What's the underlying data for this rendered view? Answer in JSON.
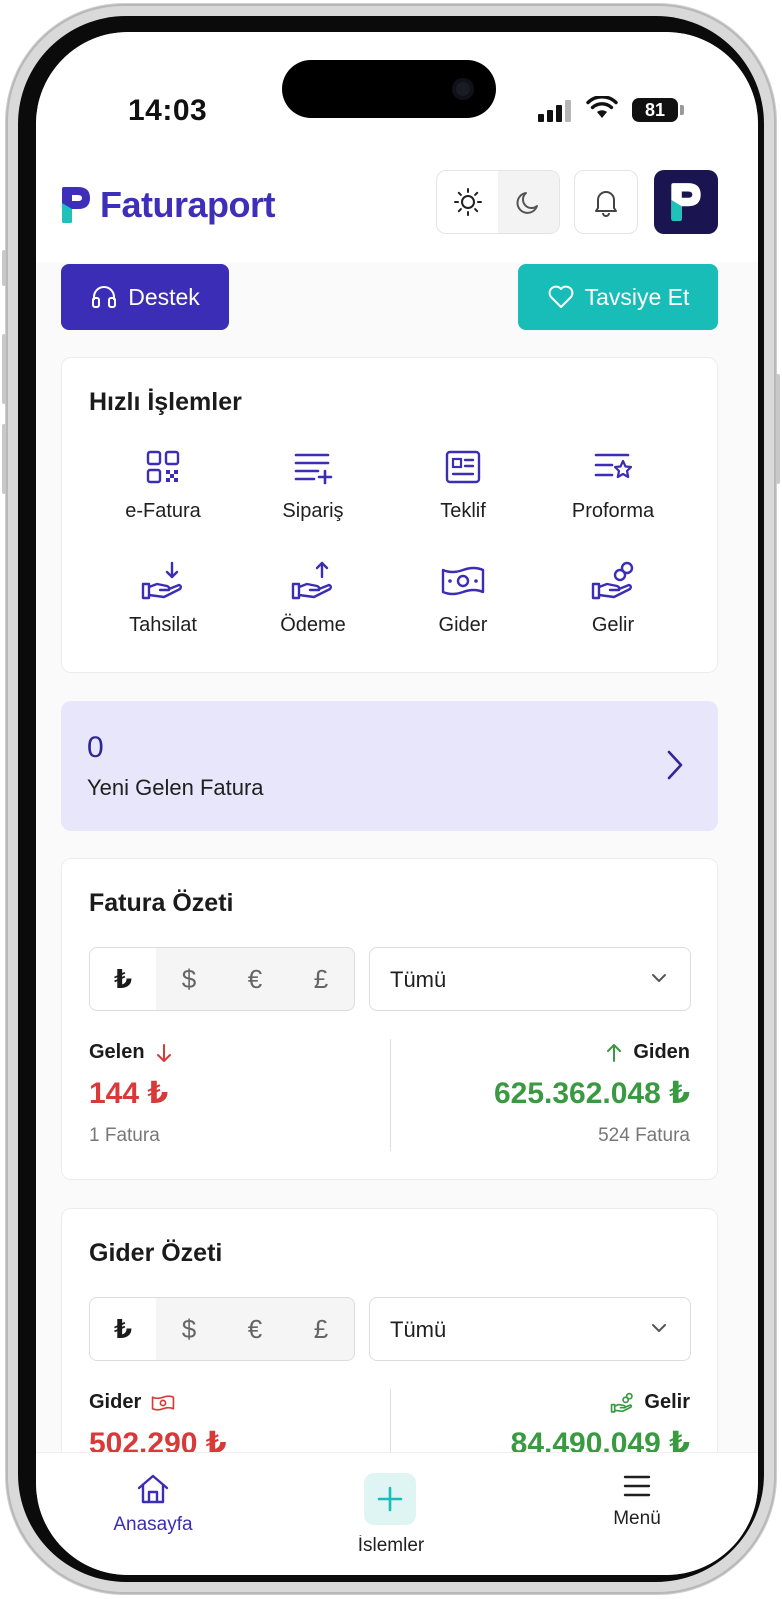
{
  "status_bar": {
    "time": "14:03",
    "battery": "81"
  },
  "header": {
    "brand": "Faturaport"
  },
  "actions": {
    "support_label": "Destek",
    "recommend_label": "Tavsiye Et"
  },
  "quick_actions": {
    "title": "Hızlı İşlemler",
    "items": [
      {
        "label": "e-Fatura",
        "icon": "qr-code-icon"
      },
      {
        "label": "Sipariş",
        "icon": "list-add-icon"
      },
      {
        "label": "Teklif",
        "icon": "document-card-icon"
      },
      {
        "label": "Proforma",
        "icon": "list-star-icon"
      },
      {
        "label": "Tahsilat",
        "icon": "hand-receive-icon"
      },
      {
        "label": "Ödeme",
        "icon": "hand-send-icon"
      },
      {
        "label": "Gider",
        "icon": "banknote-icon"
      },
      {
        "label": "Gelir",
        "icon": "hand-coins-icon"
      }
    ]
  },
  "incoming": {
    "count": "0",
    "label": "Yeni Gelen Fatura"
  },
  "invoice_summary": {
    "title": "Fatura Özeti",
    "currencies": [
      "₺",
      "$",
      "€",
      "£"
    ],
    "active_currency": "₺",
    "filter": "Tümü",
    "left": {
      "label": "Gelen",
      "amount": "144 ₺",
      "sub": "1 Fatura"
    },
    "right": {
      "label": "Giden",
      "amount": "625.362.048 ₺",
      "sub": "524 Fatura"
    }
  },
  "expense_summary": {
    "title": "Gider Özeti",
    "currencies": [
      "₺",
      "$",
      "€",
      "£"
    ],
    "active_currency": "₺",
    "filter": "Tümü",
    "left": {
      "label": "Gider",
      "amount": "502.290 ₺"
    },
    "right": {
      "label": "Gelir",
      "amount": "84.490.049 ₺"
    }
  },
  "bottom_nav": {
    "home_label": "Anasayfa",
    "add_label": "İşlemler",
    "menu_label": "Menü"
  },
  "colors": {
    "primary": "#3b2db5",
    "teal": "#17bdb6",
    "negative": "#d83a3a",
    "positive": "#3a9a42",
    "incoming_bg": "#e7e6fa"
  }
}
